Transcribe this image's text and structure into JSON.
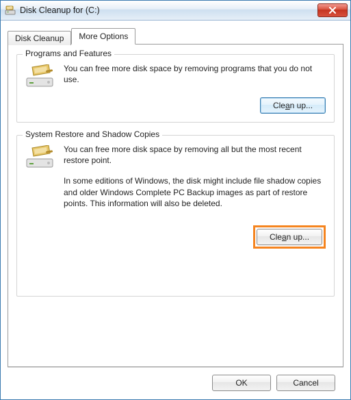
{
  "window": {
    "title": "Disk Cleanup for  (C:)"
  },
  "tabs": {
    "disk_cleanup": "Disk Cleanup",
    "more_options": "More Options"
  },
  "programs_group": {
    "title": "Programs and Features",
    "text": "You can free more disk space by removing programs that you do not use.",
    "button_before": "Cle",
    "button_u": "a",
    "button_after": "n up..."
  },
  "restore_group": {
    "title": "System Restore and Shadow Copies",
    "text1": "You can free more disk space by removing all but the most recent restore point.",
    "text2": "In some editions of Windows, the disk might include file shadow copies and older Windows Complete PC Backup images as part of restore points. This information will also be deleted.",
    "button_before": "Cle",
    "button_u": "a",
    "button_after": "n up..."
  },
  "footer": {
    "ok": "OK",
    "cancel": "Cancel"
  }
}
